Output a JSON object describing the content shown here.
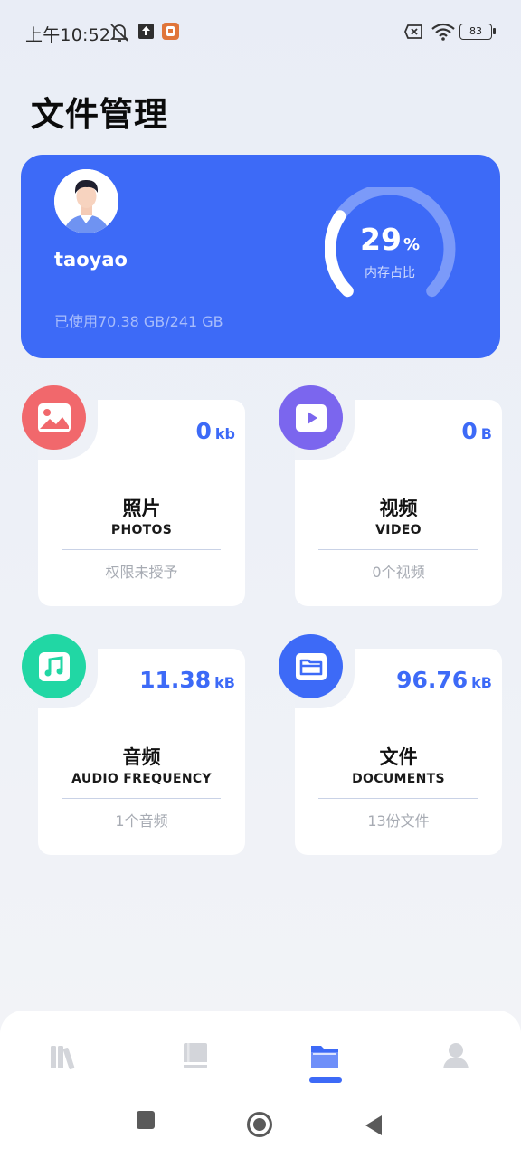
{
  "status_bar": {
    "time": "上午10:52",
    "battery": "83"
  },
  "page": {
    "title": "文件管理"
  },
  "storage": {
    "username": "taoyao",
    "usage": "已使用70.38 GB/241 GB",
    "percent": "29",
    "percent_sign": "%",
    "percent_label": "内存占比",
    "percent_value": 0.29
  },
  "categories": [
    {
      "key": "photos",
      "size": "0",
      "unit": "kb",
      "title": "照片",
      "subtitle": "PHOTOS",
      "count": "权限未授予",
      "color": "#f1686c"
    },
    {
      "key": "video",
      "size": "0",
      "unit": "B",
      "title": "视频",
      "subtitle": "VIDEO",
      "count": "0个视频",
      "color": "#7b66ee"
    },
    {
      "key": "audio",
      "size": "11.38",
      "unit": "kB",
      "title": "音频",
      "subtitle": "AUDIO FREQUENCY",
      "count": "1个音频",
      "color": "#21d7a4"
    },
    {
      "key": "documents",
      "size": "96.76",
      "unit": "kB",
      "title": "文件",
      "subtitle": "DOCUMENTS",
      "count": "13份文件",
      "color": "#3d6af7"
    }
  ],
  "bottom_nav": {
    "items": [
      "library-icon",
      "book-icon",
      "folder-icon",
      "profile-icon"
    ],
    "active": 2
  },
  "colors": {
    "accent": "#3d6af7",
    "muted": "#a7abb3"
  }
}
